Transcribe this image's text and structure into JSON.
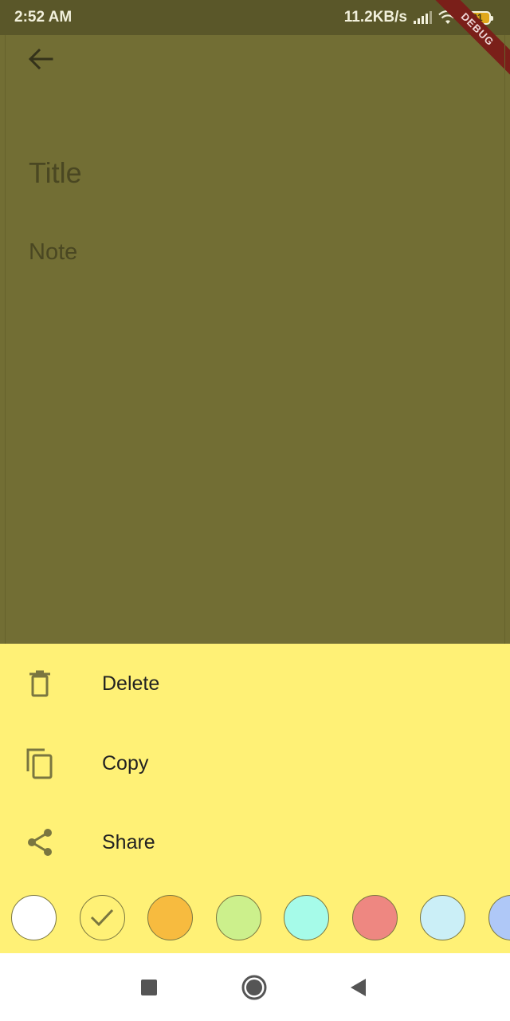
{
  "status_bar": {
    "time": "2:52 AM",
    "network_speed": "11.2KB/s",
    "battery_level": "91",
    "icons": [
      "signal-icon",
      "wifi-icon",
      "battery-icon"
    ]
  },
  "debug_banner": "DEBUG",
  "editor": {
    "back_icon": "arrow-back-icon",
    "title_placeholder": "Title",
    "note_placeholder": "Note",
    "background_color": "#726e34"
  },
  "sheet": {
    "background_color": "#fff176",
    "items": [
      {
        "label": "Delete",
        "icon": "trash-icon"
      },
      {
        "label": "Copy",
        "icon": "copy-icon"
      },
      {
        "label": "Share",
        "icon": "share-icon"
      }
    ],
    "colors": [
      {
        "hex": "#ffffff",
        "selected": false
      },
      {
        "hex": "#fff176",
        "selected": true
      },
      {
        "hex": "#f7bb3f",
        "selected": false
      },
      {
        "hex": "#ccf08c",
        "selected": false
      },
      {
        "hex": "#a6fbe9",
        "selected": false
      },
      {
        "hex": "#ee8781",
        "selected": false
      },
      {
        "hex": "#cbeff7",
        "selected": false
      },
      {
        "hex": "#afc8f7",
        "selected": false
      }
    ]
  },
  "nav_bar": {
    "buttons": [
      "recents-square-icon",
      "home-circle-icon",
      "back-triangle-icon"
    ]
  }
}
